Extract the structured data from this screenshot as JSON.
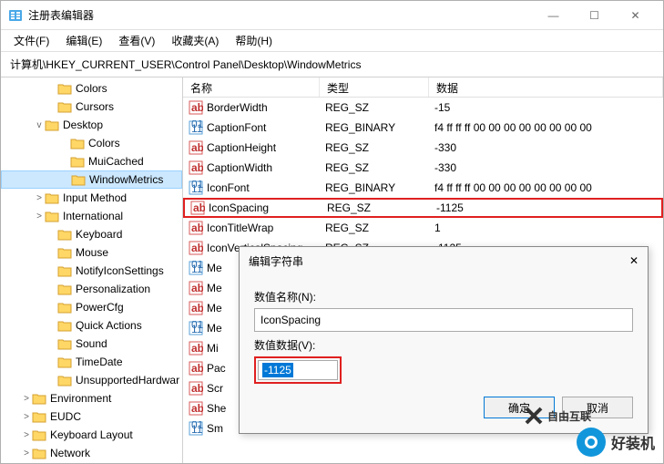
{
  "window": {
    "title": "注册表编辑器"
  },
  "menubar": [
    "文件(F)",
    "编辑(E)",
    "查看(V)",
    "收藏夹(A)",
    "帮助(H)"
  ],
  "addressbar": "计算机\\HKEY_CURRENT_USER\\Control Panel\\Desktop\\WindowMetrics",
  "tree": [
    {
      "indent": 3,
      "expander": "",
      "label": "Colors"
    },
    {
      "indent": 3,
      "expander": "",
      "label": "Cursors"
    },
    {
      "indent": 2,
      "expander": "v",
      "label": "Desktop"
    },
    {
      "indent": 4,
      "expander": "",
      "label": "Colors"
    },
    {
      "indent": 4,
      "expander": "",
      "label": "MuiCached"
    },
    {
      "indent": 4,
      "expander": "",
      "label": "WindowMetrics",
      "selected": true
    },
    {
      "indent": 2,
      "expander": ">",
      "label": "Input Method"
    },
    {
      "indent": 2,
      "expander": ">",
      "label": "International"
    },
    {
      "indent": 3,
      "expander": "",
      "label": "Keyboard"
    },
    {
      "indent": 3,
      "expander": "",
      "label": "Mouse"
    },
    {
      "indent": 3,
      "expander": "",
      "label": "NotifyIconSettings"
    },
    {
      "indent": 3,
      "expander": "",
      "label": "Personalization"
    },
    {
      "indent": 3,
      "expander": "",
      "label": "PowerCfg"
    },
    {
      "indent": 3,
      "expander": "",
      "label": "Quick Actions"
    },
    {
      "indent": 3,
      "expander": "",
      "label": "Sound"
    },
    {
      "indent": 3,
      "expander": "",
      "label": "TimeDate"
    },
    {
      "indent": 3,
      "expander": "",
      "label": "UnsupportedHardwar"
    },
    {
      "indent": 1,
      "expander": ">",
      "label": "Environment"
    },
    {
      "indent": 1,
      "expander": ">",
      "label": "EUDC"
    },
    {
      "indent": 1,
      "expander": ">",
      "label": "Keyboard Layout"
    },
    {
      "indent": 1,
      "expander": ">",
      "label": "Network"
    }
  ],
  "columns": {
    "name": "名称",
    "type": "类型",
    "data": "数据"
  },
  "rows": [
    {
      "icon": "ab",
      "name": "BorderWidth",
      "type": "REG_SZ",
      "data": "-15"
    },
    {
      "icon": "bin",
      "name": "CaptionFont",
      "type": "REG_BINARY",
      "data": "f4 ff ff ff 00 00 00 00 00 00 00 00"
    },
    {
      "icon": "ab",
      "name": "CaptionHeight",
      "type": "REG_SZ",
      "data": "-330"
    },
    {
      "icon": "ab",
      "name": "CaptionWidth",
      "type": "REG_SZ",
      "data": "-330"
    },
    {
      "icon": "bin",
      "name": "IconFont",
      "type": "REG_BINARY",
      "data": "f4 ff ff ff 00 00 00 00 00 00 00 00"
    },
    {
      "icon": "ab",
      "name": "IconSpacing",
      "type": "REG_SZ",
      "data": "-1125",
      "highlight": true
    },
    {
      "icon": "ab",
      "name": "IconTitleWrap",
      "type": "REG_SZ",
      "data": "1"
    },
    {
      "icon": "ab",
      "name": "IconVerticalSpacing",
      "type": "REG_SZ",
      "data": "-1125"
    },
    {
      "icon": "bin",
      "name": "Me",
      "type": "",
      "data": ""
    },
    {
      "icon": "ab",
      "name": "Me",
      "type": "",
      "data": ""
    },
    {
      "icon": "ab",
      "name": "Me",
      "type": "",
      "data": ""
    },
    {
      "icon": "bin",
      "name": "Me",
      "type": "",
      "data": ""
    },
    {
      "icon": "ab",
      "name": "Mi",
      "type": "",
      "data": ""
    },
    {
      "icon": "ab",
      "name": "Pac",
      "type": "",
      "data": ""
    },
    {
      "icon": "ab",
      "name": "Scr",
      "type": "",
      "data": ""
    },
    {
      "icon": "ab",
      "name": "She",
      "type": "",
      "data": ""
    },
    {
      "icon": "bin",
      "name": "Sm",
      "type": "",
      "data": ""
    }
  ],
  "dialog": {
    "title": "编辑字符串",
    "name_label": "数值名称(N):",
    "name_value": "IconSpacing",
    "data_label": "数值数据(V):",
    "data_value": "-1125",
    "ok": "确定",
    "cancel": "取消"
  },
  "watermark": {
    "brand1": "自由互联",
    "brand2": "好装机"
  }
}
